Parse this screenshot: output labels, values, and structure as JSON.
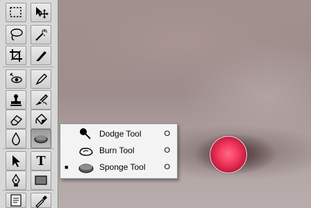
{
  "toolbox": {
    "tools": [
      {
        "name": "rectangular-marquee-tool"
      },
      {
        "name": "move-tool"
      },
      {
        "name": "lasso-tool"
      },
      {
        "name": "magic-wand-tool"
      },
      {
        "name": "crop-tool"
      },
      {
        "name": "slice-tool"
      },
      {
        "name": "healing-brush-tool"
      },
      {
        "name": "brush-tool"
      },
      {
        "name": "clone-stamp-tool"
      },
      {
        "name": "history-brush-tool"
      },
      {
        "name": "eraser-tool"
      },
      {
        "name": "paint-bucket-tool"
      },
      {
        "name": "blur-tool"
      },
      {
        "name": "sponge-tool",
        "selected": true
      },
      {
        "name": "path-selection-tool"
      },
      {
        "name": "type-tool",
        "label": "T"
      },
      {
        "name": "pen-tool"
      },
      {
        "name": "rectangle-shape-tool"
      },
      {
        "name": "notes-tool"
      },
      {
        "name": "eyedropper-tool"
      }
    ]
  },
  "flyout": {
    "items": [
      {
        "label": "Dodge Tool",
        "shortcut": "O",
        "icon": "dodge-icon",
        "active": false
      },
      {
        "label": "Burn Tool",
        "shortcut": "O",
        "icon": "burn-icon",
        "active": false
      },
      {
        "label": "Sponge Tool",
        "shortcut": "O",
        "icon": "sponge-icon",
        "active": true,
        "marker": "■"
      }
    ]
  },
  "colors": {
    "toolbox_bg": "#d8d8d8",
    "menu_bg": "#f3f3f3",
    "brush_cursor_fill": "#f53d62"
  }
}
